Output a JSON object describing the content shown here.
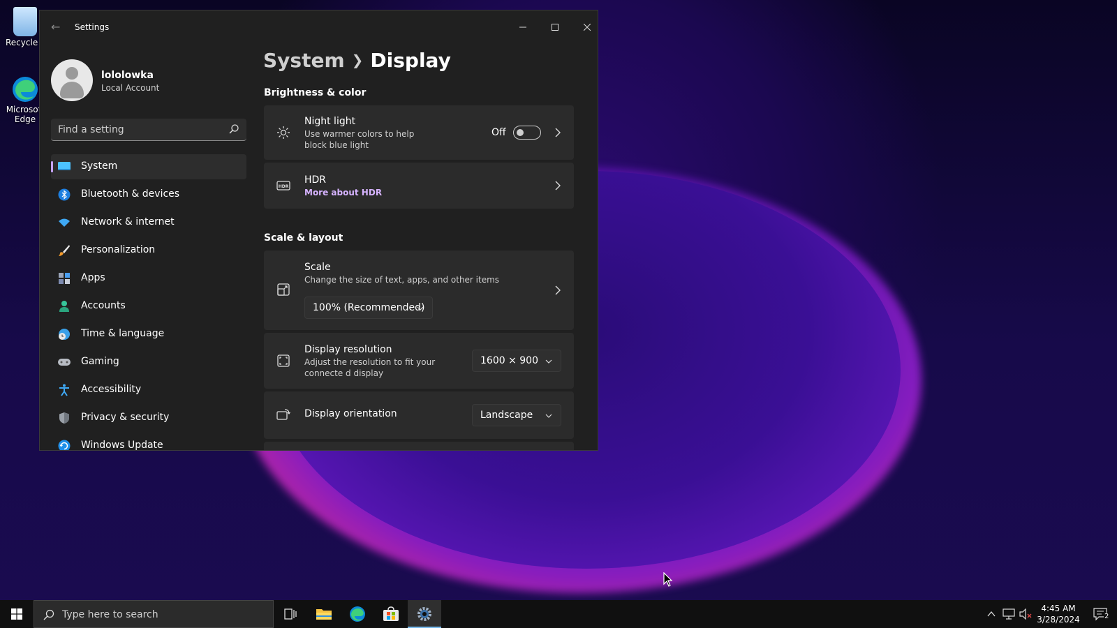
{
  "desktop": {
    "icons": [
      {
        "label": "Recycle Bin"
      },
      {
        "label": "Microsoft Edge"
      }
    ]
  },
  "window": {
    "title": "Settings",
    "back_icon": "back-arrow-icon",
    "controls": [
      "minimize-icon",
      "maximize-icon",
      "close-icon"
    ]
  },
  "profile": {
    "name": "lololowka",
    "account_type": "Local Account"
  },
  "search": {
    "placeholder": "Find a setting"
  },
  "sidebar": {
    "items": [
      {
        "label": "System",
        "icon": "monitor-icon",
        "active": true
      },
      {
        "label": "Bluetooth & devices",
        "icon": "bluetooth-icon"
      },
      {
        "label": "Network & internet",
        "icon": "wifi-icon"
      },
      {
        "label": "Personalization",
        "icon": "brush-icon"
      },
      {
        "label": "Apps",
        "icon": "apps-icon"
      },
      {
        "label": "Accounts",
        "icon": "person-icon"
      },
      {
        "label": "Time & language",
        "icon": "globe-clock-icon"
      },
      {
        "label": "Gaming",
        "icon": "gamepad-icon"
      },
      {
        "label": "Accessibility",
        "icon": "accessibility-icon"
      },
      {
        "label": "Privacy & security",
        "icon": "shield-icon"
      },
      {
        "label": "Windows Update",
        "icon": "update-icon"
      }
    ]
  },
  "main": {
    "breadcrumb": {
      "parent": "System",
      "current": "Display"
    },
    "sections": {
      "brightness": "Brightness & color",
      "scale_layout": "Scale & layout"
    },
    "night_light": {
      "title": "Night light",
      "desc": "Use warmer colors to help block blue light",
      "state": "Off"
    },
    "hdr": {
      "title": "HDR",
      "link": "More about HDR"
    },
    "scale": {
      "title": "Scale",
      "desc": "Change the size of text, apps, and other items",
      "value": "100% (Recommended)"
    },
    "resolution": {
      "title": "Display resolution",
      "desc": "Adjust the resolution to fit your connecte d display",
      "value": "1600 × 900"
    },
    "orientation": {
      "title": "Display orientation",
      "value": "Landscape"
    }
  },
  "taskbar": {
    "search_placeholder": "Type here to search",
    "time": "4:45 AM",
    "date": "3/28/2024",
    "notification_count": "2"
  },
  "colors": {
    "accent": "#c5a3ff",
    "link": "#d6b3ff",
    "window_bg": "#202020",
    "card_bg": "#2b2b2b"
  }
}
